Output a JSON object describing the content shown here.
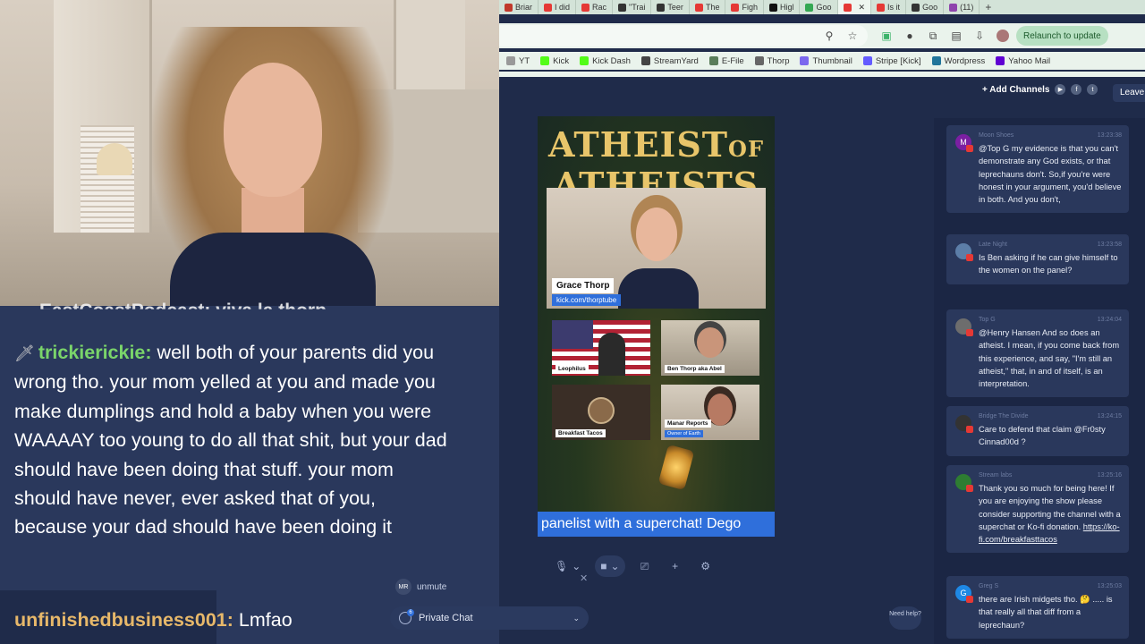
{
  "browser": {
    "tabs": [
      {
        "label": "Briar",
        "color": "#c0392b"
      },
      {
        "label": "I did",
        "color": "#e53935"
      },
      {
        "label": "Rac",
        "color": "#e53935"
      },
      {
        "label": "\"Trai",
        "color": "#333333"
      },
      {
        "label": "Teer",
        "color": "#333333"
      },
      {
        "label": "The",
        "color": "#e53935"
      },
      {
        "label": "Figh",
        "color": "#e53935"
      },
      {
        "label": "Higl",
        "color": "#111111"
      },
      {
        "label": "Goo",
        "color": "#34a853"
      },
      {
        "label": "",
        "color": "#e53935",
        "active": true
      },
      {
        "label": "Is it",
        "color": "#e53935"
      },
      {
        "label": "Goo",
        "color": "#333333"
      },
      {
        "label": "(11)",
        "color": "#8e44ad"
      }
    ],
    "relaunch_label": "Relaunch to update",
    "bookmarks": [
      {
        "label": "YT",
        "color": "#999999"
      },
      {
        "label": "Kick",
        "color": "#53fc18"
      },
      {
        "label": "Kick Dash",
        "color": "#53fc18"
      },
      {
        "label": "StreamYard",
        "color": "#444444"
      },
      {
        "label": "E-File",
        "color": "#5a7d5a"
      },
      {
        "label": "Thorp",
        "color": "#666666"
      },
      {
        "label": "Thumbnail",
        "color": "#7b68ee"
      },
      {
        "label": "Stripe [Kick]",
        "color": "#635bff"
      },
      {
        "label": "Wordpress",
        "color": "#21759b"
      },
      {
        "label": "Yahoo Mail",
        "color": "#6001d2"
      }
    ]
  },
  "overlay": {
    "prev_line": "EastCoastPodcast: viva la thorp",
    "msg1_name": "trickierickie:",
    "msg1_text": " well both of your parents did you wrong tho. your mom yelled at you and made you make dumplings and hold a baby when you were WAAAAY too young to do all that shit, but your dad should have been doing that stuff. your mom should have never, ever asked that of you, because your dad should have been doing it",
    "msg2_name": "unfinishedbusiness001:",
    "msg2_text": " Lmfao"
  },
  "stage": {
    "title_1": "ATHEIST",
    "title_of": "OF",
    "title_2": "ATHEISTS",
    "host_name": "Grace Thorp",
    "host_link": "kick.com/thorptube",
    "guests": [
      {
        "name": "Leophilus",
        "sub": ""
      },
      {
        "name": "Ben Thorp aka Abel",
        "sub": ""
      },
      {
        "name": "Breakfast Tacos",
        "sub": ""
      },
      {
        "name": "Manar Reports",
        "sub": "Owner of Earth"
      }
    ],
    "ticker": "panelist with a superchat! Dego"
  },
  "controls": {
    "unmute_initials": "MR",
    "unmute_label": "unmute",
    "private_chat_label": "Private Chat",
    "private_chat_badge": "6",
    "need_help": "Need help?",
    "add_channels": "+ Add Channels",
    "leave": "Leave"
  },
  "chat": {
    "messages": [
      {
        "initial": "M",
        "color": "#7b1fa2",
        "user": "Moon Shoes",
        "time": "13:23:38",
        "text": "@Top G my evidence is that you can't demonstrate any God exists, or that leprechauns don't. So,if you're were honest in your argument, you'd believe in both. And you don't,"
      },
      {
        "initial": "",
        "color": "#5c7ea8",
        "user": "Late Night",
        "time": "13:23:58",
        "text": "Is Ben asking if he can give himself to the women on the panel?"
      },
      {
        "initial": "",
        "color": "#6d6d6d",
        "user": "Top G",
        "time": "13:24:04",
        "text": "@Henry Hansen And so does an atheist. I mean, if you come back from this experience, and say, \"I'm still an atheist,\" that, in and of itself, is an interpretation."
      },
      {
        "initial": "",
        "color": "#333333",
        "user": "Bridge The Divide",
        "time": "13:24:15",
        "text": "Care to defend that claim @Fr0sty Cinnad00d ?"
      },
      {
        "initial": "",
        "color": "#2e7d32",
        "user": "Stream labs",
        "time": "13:25:16",
        "text": "Thank you so much for being here! If you are enjoying the show please consider supporting the channel with a superchat or Ko-fi donation. ",
        "link": "https://ko-fi.com/breakfasttacos"
      },
      {
        "initial": "G",
        "color": "#1e88e5",
        "user": "Greg S",
        "time": "13:25:03",
        "text": "there are Irish midgets tho. 🤔 ..... is that really all that diff from a leprechaun?"
      }
    ]
  }
}
